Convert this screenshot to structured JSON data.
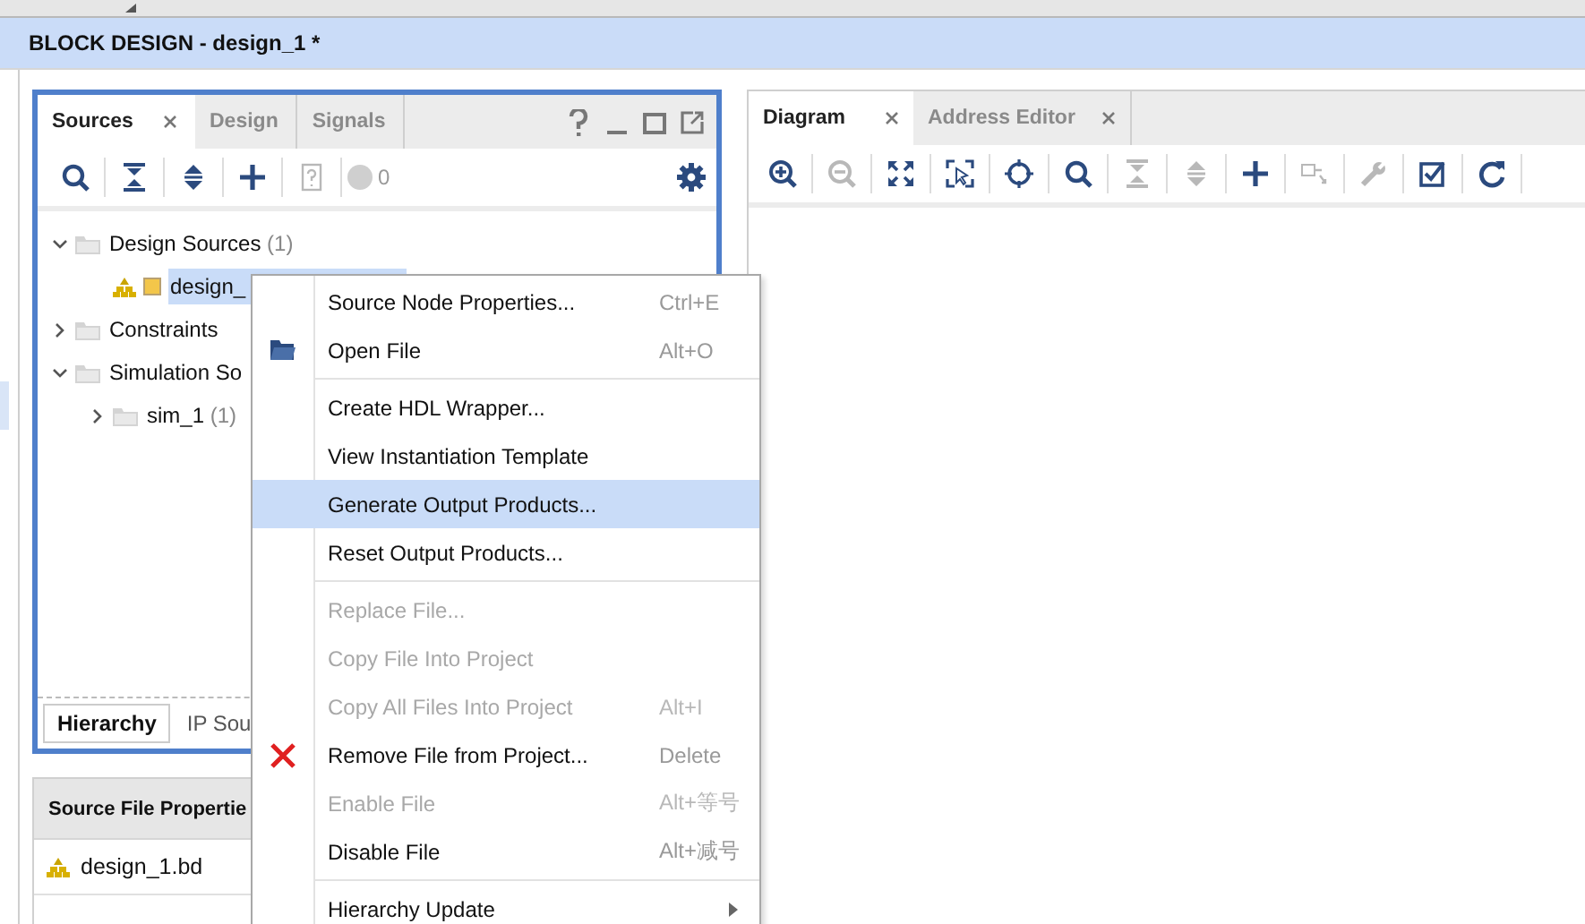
{
  "title": "BLOCK DESIGN - design_1 *",
  "sources_panel": {
    "tabs": [
      {
        "label": "Sources",
        "selected": true,
        "closable": true
      },
      {
        "label": "Design",
        "selected": false,
        "closable": false
      },
      {
        "label": "Signals",
        "selected": false,
        "closable": false
      }
    ],
    "toolbar": [
      {
        "kind": "search",
        "disabled": false
      },
      {
        "kind": "collapse",
        "disabled": false
      },
      {
        "kind": "expand",
        "disabled": false
      },
      {
        "kind": "add",
        "disabled": false
      },
      {
        "kind": "help-file",
        "disabled": true
      }
    ],
    "status_count": "0",
    "tree": [
      {
        "label": "Design Sources",
        "count": "(1)",
        "expanded": true,
        "selected": false,
        "kind": "folder",
        "children": [
          {
            "label": "design_",
            "selected": true,
            "kind": "block-design"
          }
        ]
      },
      {
        "label": "Constraints",
        "expanded": false,
        "selected": false,
        "kind": "folder"
      },
      {
        "label": "Simulation So",
        "expanded": true,
        "selected": false,
        "kind": "folder",
        "children": [
          {
            "label": "sim_1",
            "count": "(1)",
            "expanded": false,
            "selected": false,
            "kind": "folder"
          }
        ]
      }
    ],
    "bottom_tabs": [
      {
        "label": "Hierarchy",
        "selected": true
      },
      {
        "label": "IP Sou",
        "selected": false
      }
    ]
  },
  "properties_panel": {
    "title": "Source File Propertie",
    "file": "design_1.bd"
  },
  "diagram_panel": {
    "tabs": [
      {
        "label": "Diagram",
        "selected": true
      },
      {
        "label": "Address Editor",
        "selected": false
      }
    ],
    "toolbar": [
      {
        "kind": "zoom-in",
        "disabled": false
      },
      {
        "kind": "zoom-out",
        "disabled": true
      },
      {
        "kind": "fit",
        "disabled": false
      },
      {
        "kind": "select-area",
        "disabled": false
      },
      {
        "kind": "crosshair",
        "disabled": false
      },
      {
        "kind": "search",
        "disabled": false
      },
      {
        "kind": "collapse",
        "disabled": true
      },
      {
        "kind": "expand",
        "disabled": true
      },
      {
        "kind": "add",
        "disabled": false
      },
      {
        "kind": "connect",
        "disabled": true
      },
      {
        "kind": "wrench",
        "disabled": true
      },
      {
        "kind": "validate",
        "disabled": false
      },
      {
        "kind": "refresh",
        "disabled": false
      }
    ]
  },
  "context_menu": [
    {
      "kind": "item",
      "label": "Source Node Properties...",
      "shortcut": "Ctrl+E",
      "disabled": false,
      "selected": false
    },
    {
      "kind": "open",
      "label": "Open File",
      "shortcut": "Alt+O",
      "disabled": false,
      "selected": false
    },
    {
      "kind": "separator"
    },
    {
      "kind": "item",
      "label": "Create HDL Wrapper...",
      "disabled": false,
      "selected": false
    },
    {
      "kind": "item",
      "label": "View Instantiation Template",
      "disabled": false,
      "selected": false
    },
    {
      "kind": "item",
      "label": "Generate Output Products...",
      "disabled": false,
      "selected": true
    },
    {
      "kind": "item",
      "label": "Reset Output Products...",
      "disabled": false,
      "selected": false
    },
    {
      "kind": "separator"
    },
    {
      "kind": "item",
      "label": "Replace File...",
      "disabled": true,
      "selected": false
    },
    {
      "kind": "item",
      "label": "Copy File Into Project",
      "disabled": true,
      "selected": false
    },
    {
      "kind": "item",
      "label": "Copy All Files Into Project",
      "shortcut": "Alt+I",
      "disabled": true,
      "selected": false
    },
    {
      "kind": "remove",
      "label": "Remove File from Project...",
      "shortcut": "Delete",
      "disabled": false,
      "selected": false
    },
    {
      "kind": "item",
      "label": "Enable File",
      "shortcut": "Alt+等号",
      "disabled": true,
      "selected": false
    },
    {
      "kind": "item",
      "label": "Disable File",
      "shortcut": "Alt+减号",
      "disabled": false,
      "selected": false
    },
    {
      "kind": "separator"
    },
    {
      "kind": "item",
      "label": "Hierarchy Update",
      "submenu": true,
      "disabled": false,
      "selected": false
    }
  ]
}
